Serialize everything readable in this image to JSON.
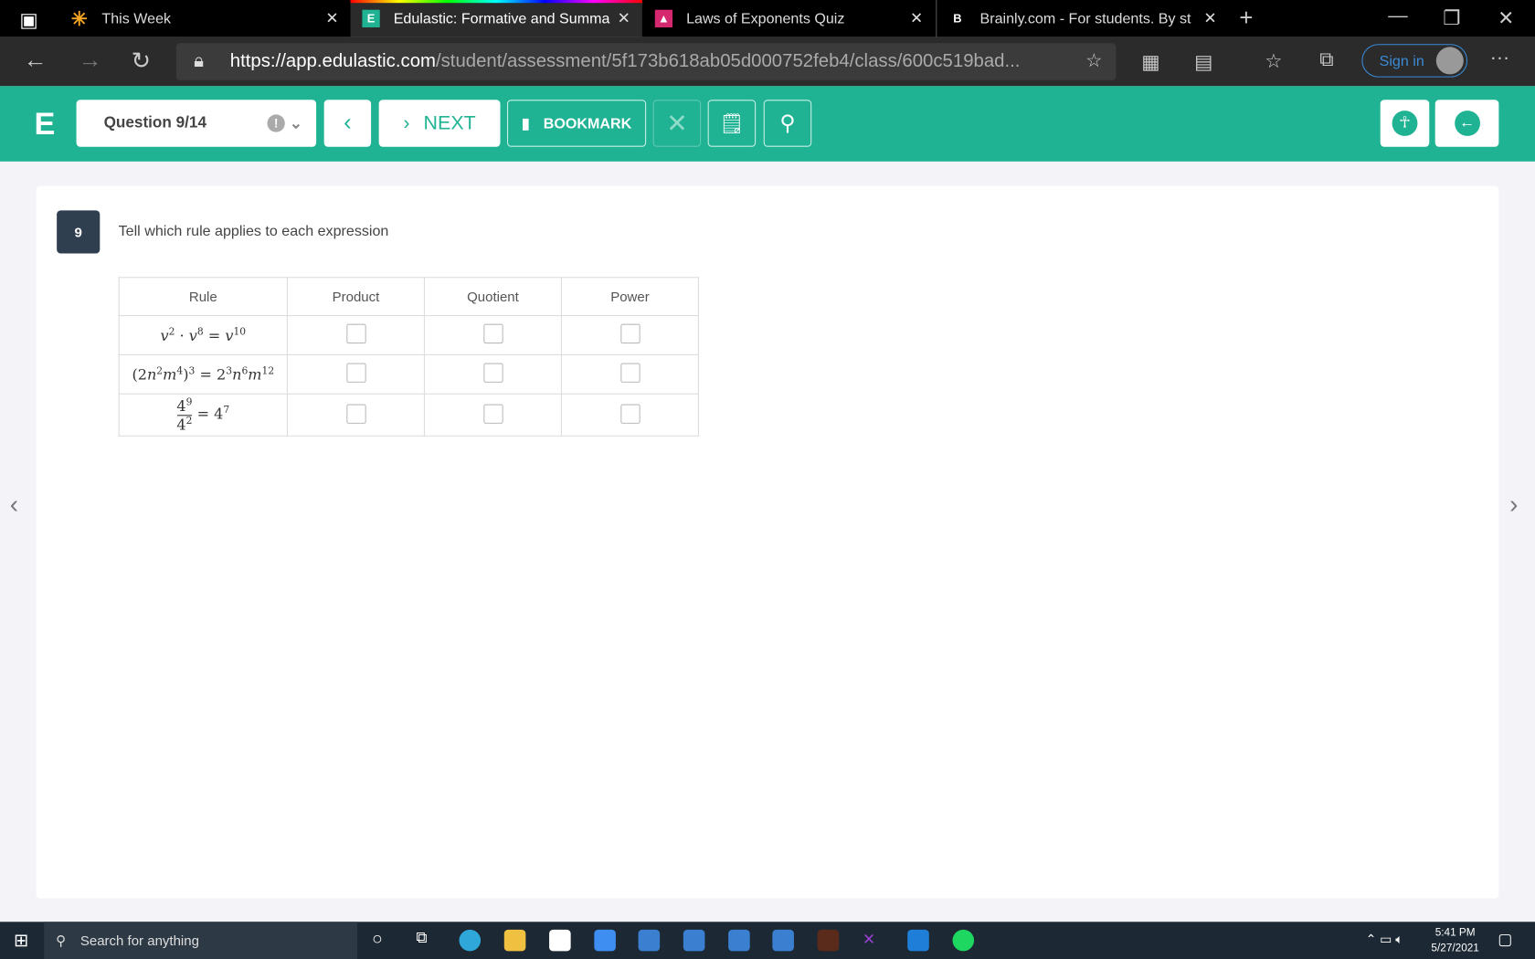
{
  "browser": {
    "tabs": [
      {
        "title": "This Week"
      },
      {
        "title": "Edulastic: Formative and Summa",
        "active": true
      },
      {
        "title": "Laws of Exponents Quiz"
      },
      {
        "title": "Brainly.com - For students. By st"
      }
    ],
    "url_host": "https://app.edulastic.com",
    "url_path": "/student/assessment/5f173b618ab05d000752feb4/class/600c519bad...",
    "sign_in": "Sign in"
  },
  "toolbar": {
    "logo": "E",
    "question_selector": "Question 9/14",
    "next": "NEXT",
    "bookmark": "BOOKMARK"
  },
  "question": {
    "number": "9",
    "prompt": "Tell which rule applies to each expression",
    "headers": [
      "Rule",
      "Product",
      "Quotient",
      "Power"
    ]
  },
  "taskbar": {
    "search_placeholder": "Search for anything",
    "time": "5:41 PM",
    "date": "5/27/2021"
  },
  "colors": {
    "accent": "#1fb394",
    "qnum_bg": "#2f3f50"
  }
}
